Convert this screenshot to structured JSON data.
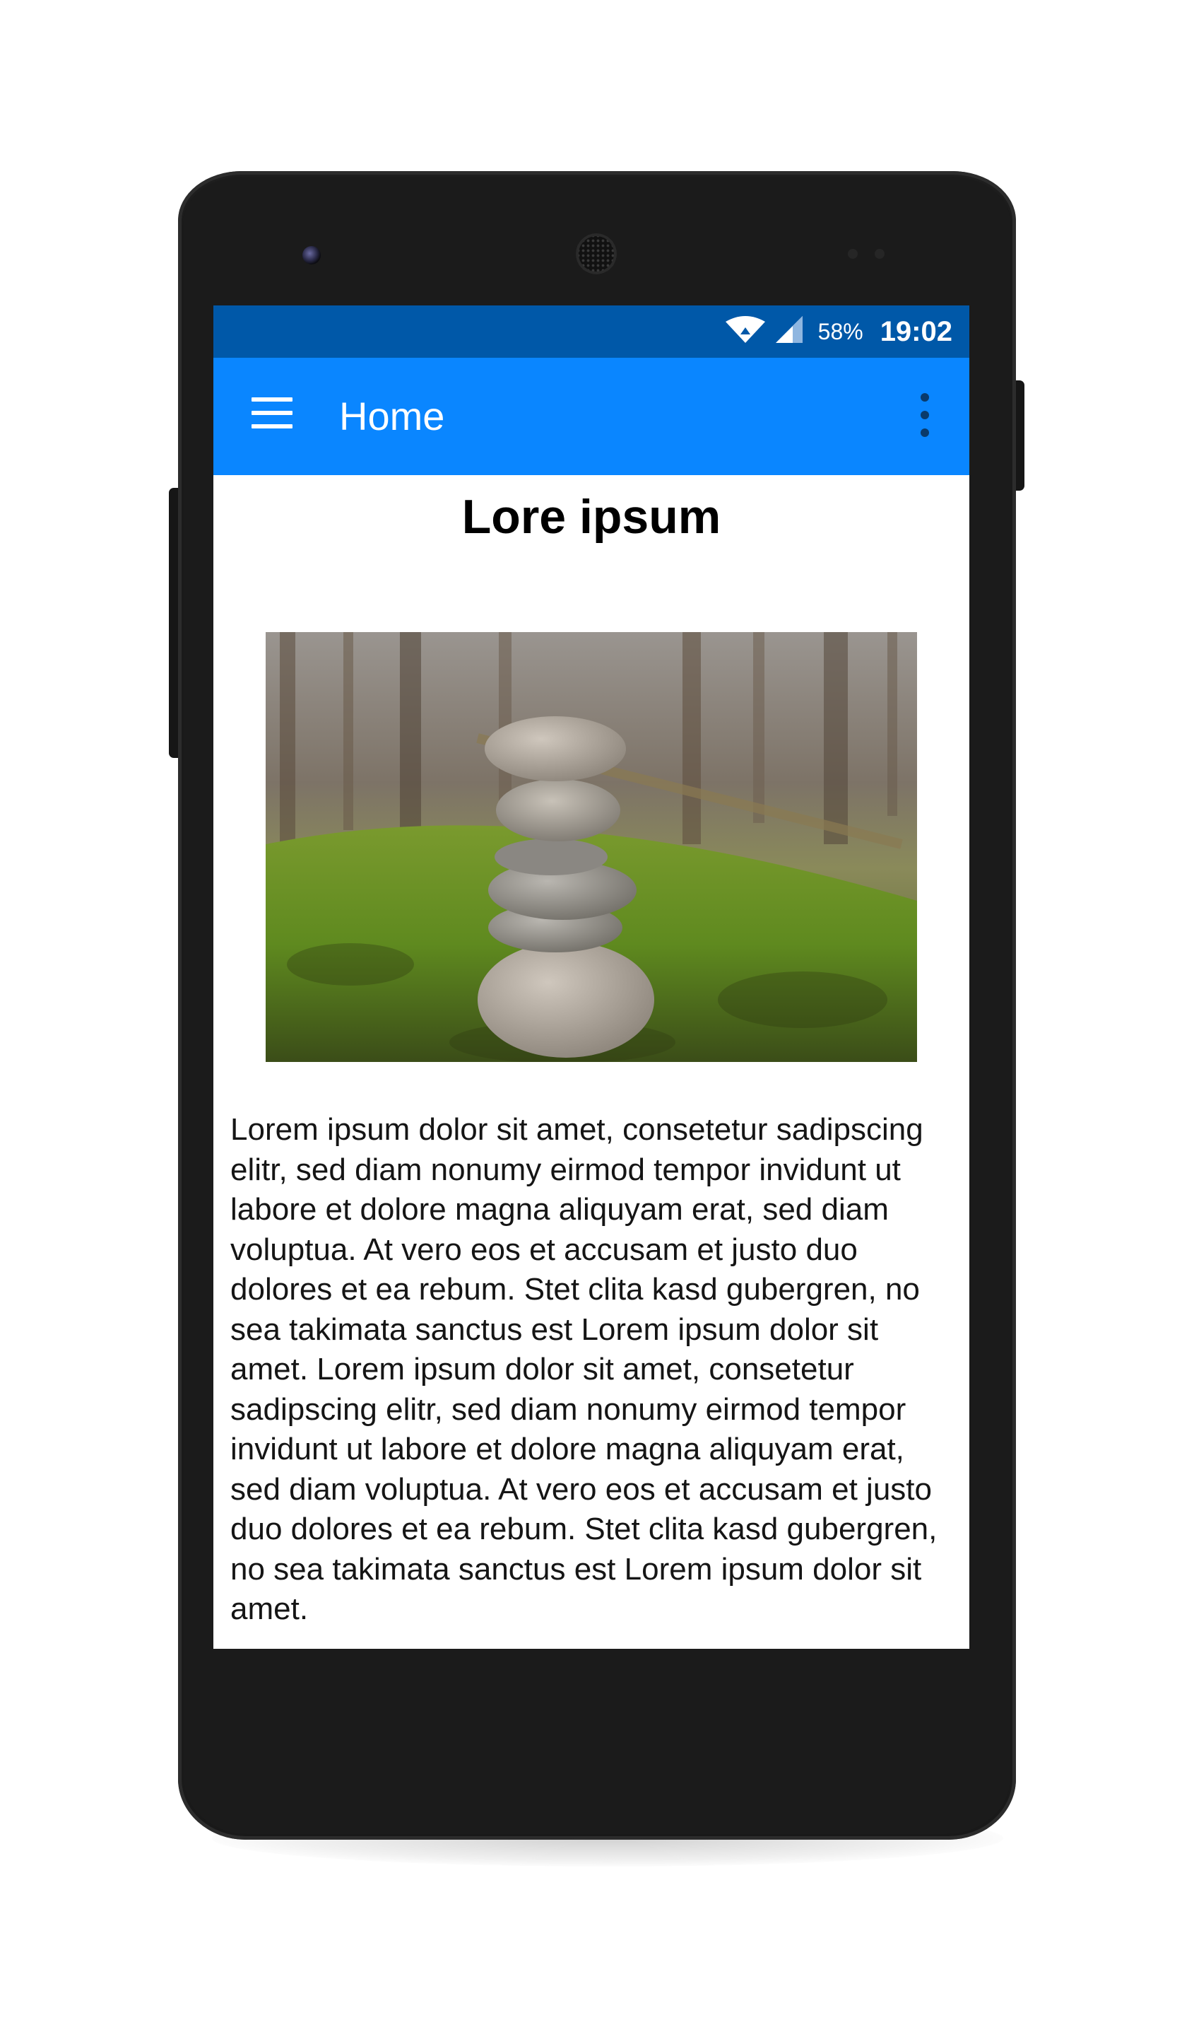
{
  "status_bar": {
    "battery": "58%",
    "time": "19:02",
    "icons": [
      "wifi-icon",
      "cellular-signal-icon"
    ]
  },
  "app_bar": {
    "title": "Home",
    "icons": [
      "menu-icon",
      "overflow-menu-icon"
    ],
    "color": "#0a86ff",
    "status_color": "#0058a8"
  },
  "content": {
    "heading": "Lore ipsum",
    "body": "Lorem ipsum dolor sit amet, consetetur sadipscing elitr, sed diam nonumy eirmod tempor invidunt ut labore et dolore magna aliquyam erat, sed diam voluptua. At vero eos et accusam et justo duo dolores et ea rebum. Stet clita kasd gubergren, no sea takimata sanctus est Lorem ipsum dolor sit amet. Lorem ipsum dolor sit amet, consetetur sadipscing elitr, sed diam nonumy eirmod tempor invidunt ut labore et dolore magna aliquyam erat, sed diam voluptua. At vero eos et accusam et justo duo dolores et ea rebum. Stet clita kasd gubergren, no sea takimata sanctus est Lorem ipsum dolor sit amet."
  }
}
